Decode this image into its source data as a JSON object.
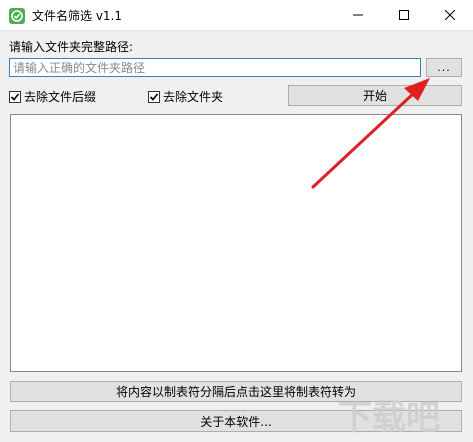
{
  "window": {
    "title": "文件名筛选 v1.1",
    "controls": {
      "minimize": "minimize",
      "maximize": "maximize",
      "close": "close"
    }
  },
  "path": {
    "label": "请输入文件夹完整路径:",
    "value": "",
    "placeholder": "请输入正确的文件夹路径",
    "browse_label": "..."
  },
  "options": {
    "remove_extension": {
      "label": "去除文件后缀",
      "checked": true
    },
    "remove_folder": {
      "label": "去除文件夹",
      "checked": true
    }
  },
  "actions": {
    "start_label": "开始",
    "convert_label": "将内容以制表符分隔后点击这里将制表符转为",
    "about_label": "关于本软件..."
  },
  "output": {
    "text": ""
  },
  "watermark": {
    "text": "下载吧"
  },
  "colors": {
    "annotation_arrow": "#e02020",
    "input_border": "#3c7fb1",
    "app_icon": "#4caf50"
  }
}
